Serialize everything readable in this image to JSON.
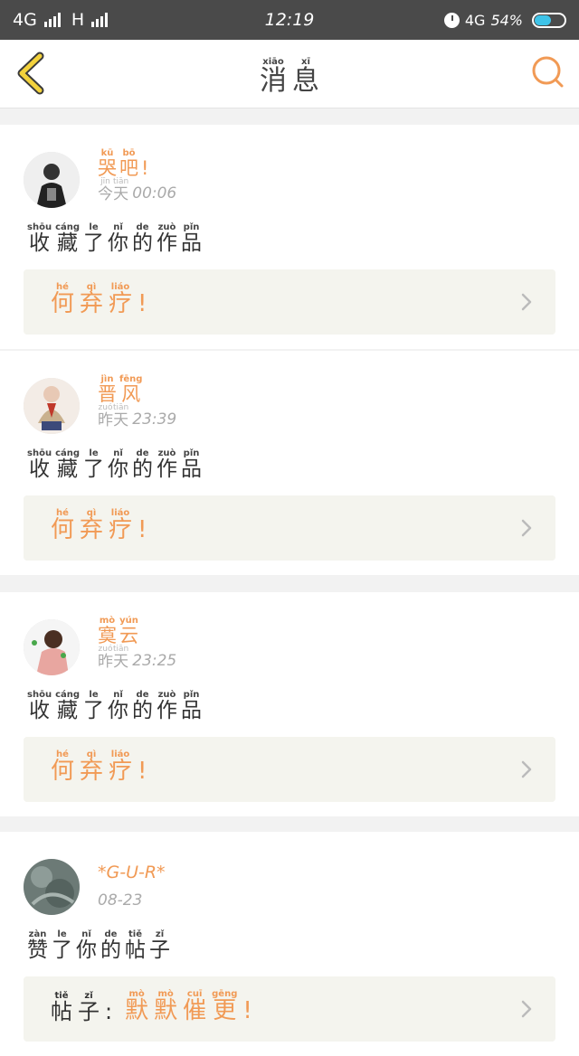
{
  "status_bar": {
    "left_text": "4G",
    "mid_text": "H",
    "time": "12:19",
    "network": "4G",
    "battery": "54%",
    "battery_level": 0.54
  },
  "nav": {
    "title": [
      {
        "py": "xiāo",
        "hz": "消"
      },
      {
        "py": "xī",
        "hz": "息"
      }
    ],
    "back_icon": "chevron-left-icon",
    "search_icon": "search-icon"
  },
  "colors": {
    "accent": "#f19a55",
    "back_yellow": "#f3d23c",
    "ref_bg": "#f4f4ee"
  },
  "messages": [
    {
      "user": [
        {
          "py": "kū",
          "hz": "哭"
        },
        {
          "py": "bō",
          "hz": "吧"
        },
        {
          "py": "",
          "hz": "!"
        }
      ],
      "time_words": [
        {
          "py": "jīn",
          "hz": "今"
        },
        {
          "py": "tiān",
          "hz": "天"
        }
      ],
      "time_value": "00:06",
      "action": [
        {
          "py": "shōu",
          "hz": "收"
        },
        {
          "py": "cáng",
          "hz": "藏"
        },
        {
          "py": "le",
          "hz": "了"
        },
        {
          "py": "nǐ",
          "hz": "你"
        },
        {
          "py": "de",
          "hz": "的"
        },
        {
          "py": "zuò",
          "hz": "作"
        },
        {
          "py": "pǐn",
          "hz": "品"
        }
      ],
      "ref_label": [],
      "ref": [
        {
          "py": "hé",
          "hz": "何"
        },
        {
          "py": "qì",
          "hz": "弃"
        },
        {
          "py": "liáo",
          "hz": "疗"
        },
        {
          "py": "",
          "hz": "!"
        }
      ]
    },
    {
      "user": [
        {
          "py": "jìn",
          "hz": "晋"
        },
        {
          "py": "fēng",
          "hz": "风"
        }
      ],
      "time_words": [
        {
          "py": "zuó",
          "hz": "昨"
        },
        {
          "py": "tiān",
          "hz": "天"
        }
      ],
      "time_value": "23:39",
      "action": [
        {
          "py": "shōu",
          "hz": "收"
        },
        {
          "py": "cáng",
          "hz": "藏"
        },
        {
          "py": "le",
          "hz": "了"
        },
        {
          "py": "nǐ",
          "hz": "你"
        },
        {
          "py": "de",
          "hz": "的"
        },
        {
          "py": "zuò",
          "hz": "作"
        },
        {
          "py": "pǐn",
          "hz": "品"
        }
      ],
      "ref_label": [],
      "ref": [
        {
          "py": "hé",
          "hz": "何"
        },
        {
          "py": "qì",
          "hz": "弃"
        },
        {
          "py": "liáo",
          "hz": "疗"
        },
        {
          "py": "",
          "hz": "!"
        }
      ]
    },
    {
      "user": [
        {
          "py": "mò",
          "hz": "寞"
        },
        {
          "py": "yún",
          "hz": "云"
        }
      ],
      "time_words": [
        {
          "py": "zuó",
          "hz": "昨"
        },
        {
          "py": "tiān",
          "hz": "天"
        }
      ],
      "time_value": "23:25",
      "action": [
        {
          "py": "shōu",
          "hz": "收"
        },
        {
          "py": "cáng",
          "hz": "藏"
        },
        {
          "py": "le",
          "hz": "了"
        },
        {
          "py": "nǐ",
          "hz": "你"
        },
        {
          "py": "de",
          "hz": "的"
        },
        {
          "py": "zuò",
          "hz": "作"
        },
        {
          "py": "pǐn",
          "hz": "品"
        }
      ],
      "ref_label": [],
      "ref": [
        {
          "py": "hé",
          "hz": "何"
        },
        {
          "py": "qì",
          "hz": "弃"
        },
        {
          "py": "liáo",
          "hz": "疗"
        },
        {
          "py": "",
          "hz": "!"
        }
      ]
    },
    {
      "user_latin": "*G-U-R*",
      "time_words": [],
      "time_value": "08-23",
      "action": [
        {
          "py": "zàn",
          "hz": "赞"
        },
        {
          "py": "le",
          "hz": "了"
        },
        {
          "py": "nǐ",
          "hz": "你"
        },
        {
          "py": "de",
          "hz": "的"
        },
        {
          "py": "tiě",
          "hz": "帖"
        },
        {
          "py": "zǐ",
          "hz": "子"
        }
      ],
      "ref_label": [
        {
          "py": "tiě",
          "hz": "帖"
        },
        {
          "py": "zǐ",
          "hz": "子"
        },
        {
          "py": "",
          "hz": ":"
        }
      ],
      "ref": [
        {
          "py": "mò",
          "hz": "默"
        },
        {
          "py": "mò",
          "hz": "默"
        },
        {
          "py": "cuī",
          "hz": "催"
        },
        {
          "py": "gēng",
          "hz": "更"
        },
        {
          "py": "",
          "hz": "!"
        }
      ]
    }
  ]
}
